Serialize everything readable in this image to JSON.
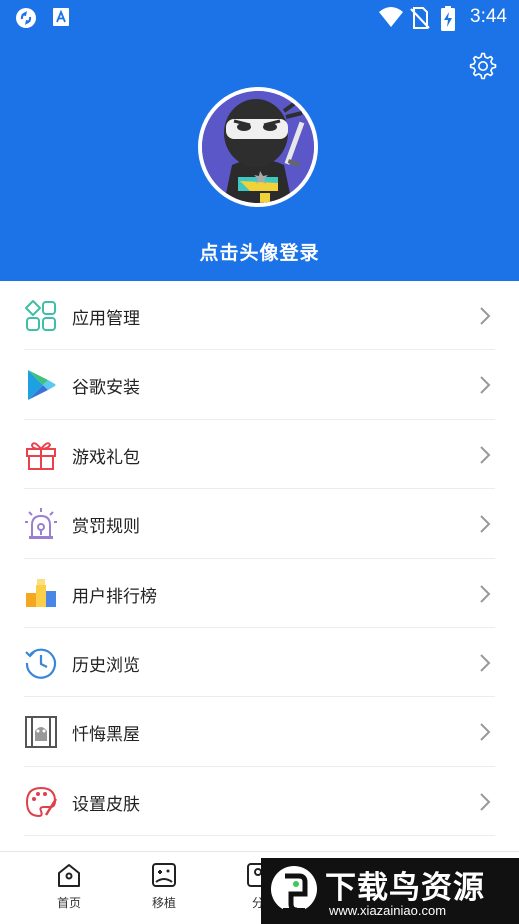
{
  "status_bar": {
    "time": "3:44",
    "icons": [
      "sync-icon",
      "a-notification-icon",
      "wifi-icon",
      "no-sim-icon",
      "battery-charging-icon"
    ]
  },
  "header": {
    "background_color": "#1c73e8",
    "settings_icon": "gear-icon",
    "avatar_icon": "ninja-avatar",
    "login_prompt": "点击头像登录"
  },
  "menu": {
    "items": [
      {
        "label": "应用管理",
        "icon": "app-grid-icon",
        "color": "#3fbfa5"
      },
      {
        "label": "谷歌安装",
        "icon": "play-store-icon",
        "color": "#1ea1e0"
      },
      {
        "label": "游戏礼包",
        "icon": "gift-icon",
        "color": "#e8434d"
      },
      {
        "label": "赏罚规则",
        "icon": "alarm-siren-icon",
        "color": "#9b7fd1"
      },
      {
        "label": "用户排行榜",
        "icon": "ranking-podium-icon",
        "color": "#f5a623"
      },
      {
        "label": "历史浏览",
        "icon": "history-clock-icon",
        "color": "#3a86d8"
      },
      {
        "label": "忏悔黑屋",
        "icon": "jail-bars-icon",
        "color": "#555555"
      },
      {
        "label": "设置皮肤",
        "icon": "palette-icon",
        "color": "#e0404a"
      }
    ]
  },
  "bottom_nav": {
    "items": [
      {
        "label": "首页",
        "icon": "home-icon"
      },
      {
        "label": "移植",
        "icon": "gamepad-icon"
      },
      {
        "label": "分",
        "icon": "category-icon"
      }
    ]
  },
  "watermark": {
    "title": "下载鸟资源",
    "url": "www.xiazainiao.com"
  }
}
